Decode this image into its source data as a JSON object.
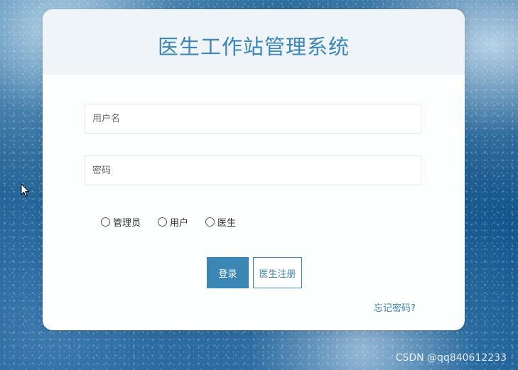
{
  "header": {
    "title": "医生工作站管理系统"
  },
  "form": {
    "username_placeholder": "用户名",
    "password_placeholder": "密码",
    "roles": [
      {
        "label": "管理员",
        "icon": "radio-unchecked-icon"
      },
      {
        "label": "用户",
        "icon": "radio-unchecked-icon"
      },
      {
        "label": "医生",
        "icon": "radio-unchecked-icon"
      }
    ],
    "login_label": "登录",
    "register_label": "医生注册",
    "forgot_label": "忘记密码?"
  },
  "watermark": "CSDN @qq840612233",
  "colors": {
    "accent": "#3a86b5",
    "title": "#3c86b8",
    "header_bg": "#eef4f8"
  },
  "icons": {
    "cursor": "mouse-pointer-icon"
  }
}
